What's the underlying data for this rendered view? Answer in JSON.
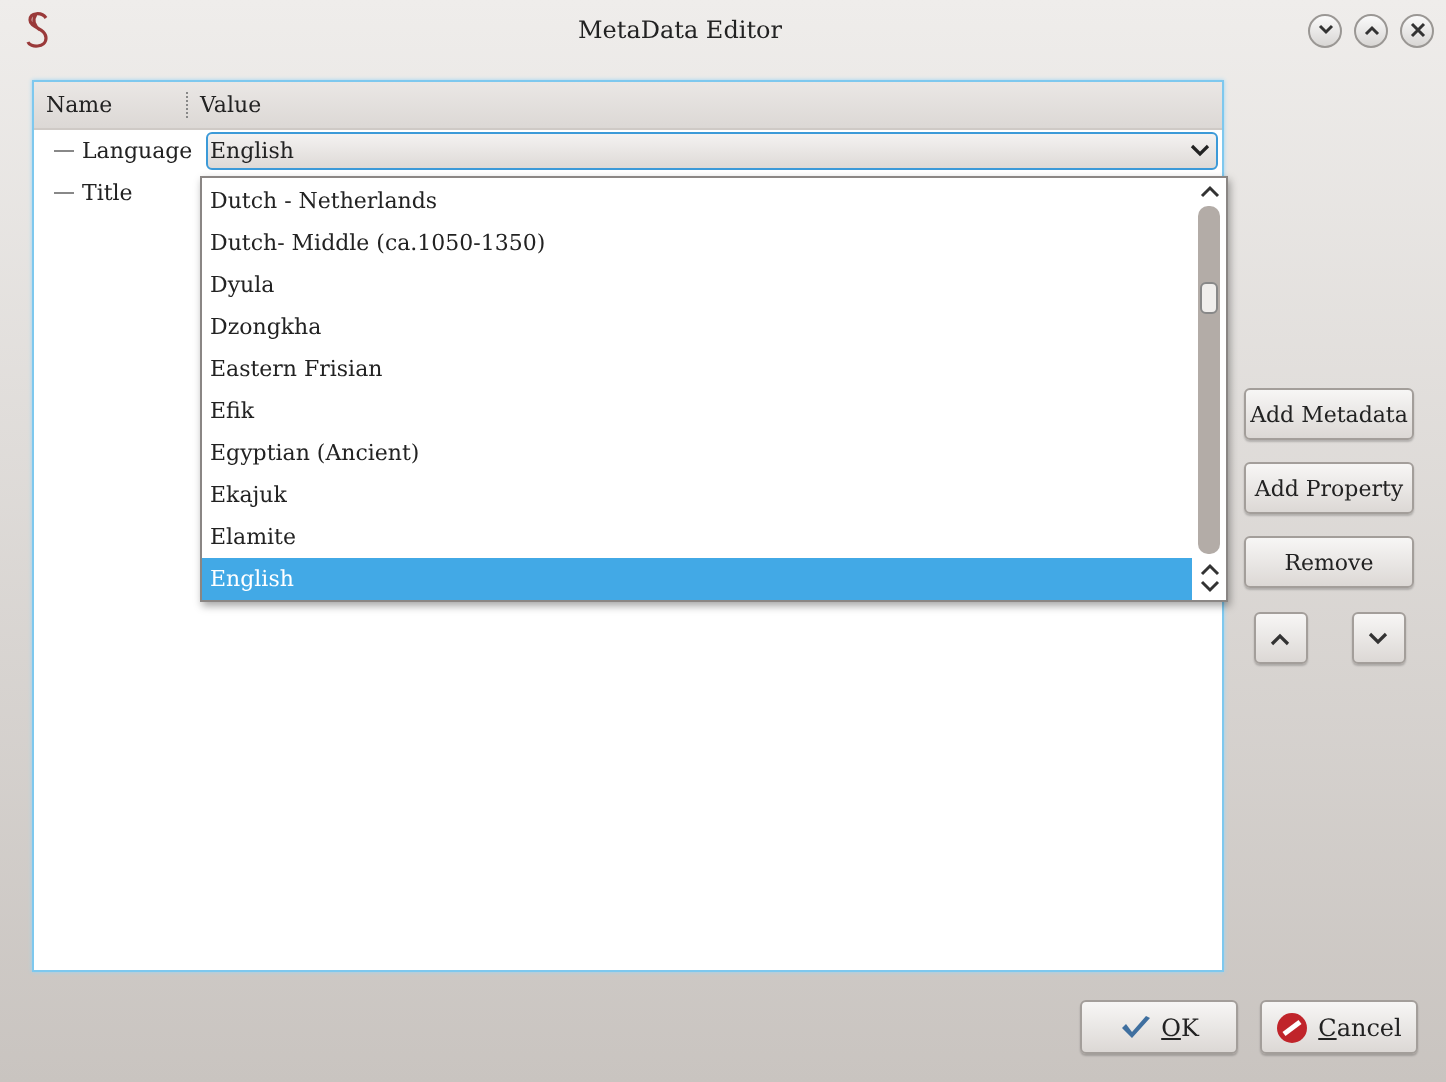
{
  "window": {
    "title": "MetaData Editor"
  },
  "tree": {
    "columns": [
      "Name",
      "Value"
    ],
    "rows": [
      {
        "name": "Language",
        "value": "English",
        "kind": "combo"
      },
      {
        "name": "Title",
        "kind": "plain"
      }
    ]
  },
  "dropdown": {
    "items": [
      {
        "label": "Dutch - Netherlands",
        "selected": false
      },
      {
        "label": "Dutch- Middle (ca.1050-1350)",
        "selected": false
      },
      {
        "label": "Dyula",
        "selected": false
      },
      {
        "label": "Dzongkha",
        "selected": false
      },
      {
        "label": "Eastern Frisian",
        "selected": false
      },
      {
        "label": "Efik",
        "selected": false
      },
      {
        "label": "Egyptian (Ancient)",
        "selected": false
      },
      {
        "label": "Ekajuk",
        "selected": false
      },
      {
        "label": "Elamite",
        "selected": false
      },
      {
        "label": "English",
        "selected": true
      }
    ]
  },
  "side_buttons": [
    "Add Metadata",
    "Add Property",
    "Remove"
  ],
  "buttons": [
    {
      "label": "OK",
      "kind": "ok"
    },
    {
      "label": "Cancel",
      "kind": "cancel"
    }
  ]
}
